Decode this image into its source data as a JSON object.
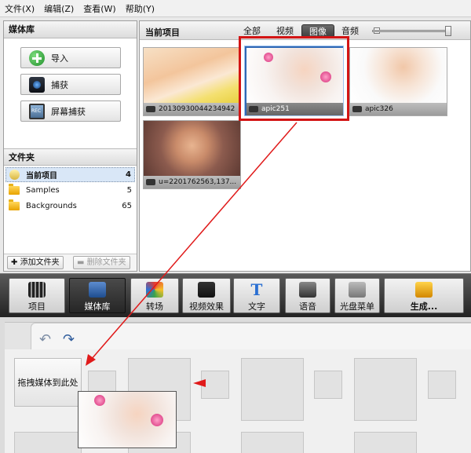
{
  "menu": [
    "文件(X)",
    "编辑(Z)",
    "查看(W)",
    "帮助(Y)"
  ],
  "media_library": {
    "title": "媒体库",
    "buttons": {
      "import": "导入",
      "capture": "捕获",
      "screen_capture": "屏幕捕获"
    }
  },
  "folders": {
    "title": "文件夹",
    "items": [
      {
        "name": "当前项目",
        "count": "4"
      },
      {
        "name": "Samples",
        "count": "5"
      },
      {
        "name": "Backgrounds",
        "count": "65"
      }
    ],
    "add": "添加文件夹",
    "delete": "删除文件夹"
  },
  "current_project": {
    "title": "当前项目",
    "tabs": [
      "全部",
      "视频",
      "图像",
      "音频"
    ],
    "active_tab": "图像",
    "thumbs": [
      {
        "caption": "20130930044234942",
        "colors": "baby1"
      },
      {
        "caption": "apic251",
        "colors": "baby2"
      },
      {
        "caption": "apic326",
        "colors": "baby3"
      },
      {
        "caption": "u=2201762563,137...",
        "colors": "baby4"
      }
    ]
  },
  "toolbar": {
    "items": [
      "项目",
      "媒体库",
      "转场",
      "视频效果",
      "文字",
      "语音",
      "光盘菜单",
      "生成..."
    ]
  },
  "timeline": {
    "undo_icon": "undo-icon",
    "redo_icon": "redo-icon",
    "drop_label": "拖拽媒体到此处"
  },
  "colors": {
    "highlight": "#d31414",
    "selection": "#2f68b5",
    "arrow": "#e01a1a"
  }
}
